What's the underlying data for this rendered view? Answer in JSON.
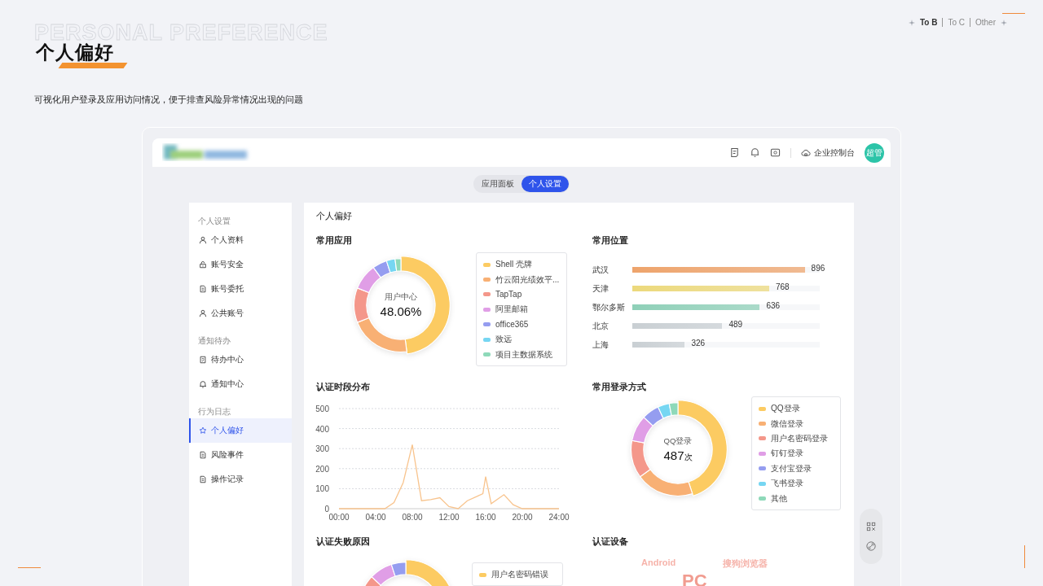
{
  "header": {
    "ghost_title": "PERSONAL PREFERENCE",
    "title": "个人偏好",
    "subtitle": "可视化用户登录及应用访问情况，便于排查风险异常情况出现的问题"
  },
  "audience_tabs": [
    {
      "label": "To B",
      "selected": true
    },
    {
      "label": "To C",
      "selected": false
    },
    {
      "label": "Other",
      "selected": false
    }
  ],
  "app": {
    "topbar": {
      "console_label": "企业控制台",
      "avatar": "超管"
    },
    "tabs": [
      {
        "label": "应用面板",
        "selected": false
      },
      {
        "label": "个人设置",
        "selected": true
      }
    ],
    "sidebar": [
      {
        "group": "个人设置",
        "items": [
          {
            "label": "个人资料",
            "selected": false
          },
          {
            "label": "账号安全",
            "selected": false
          },
          {
            "label": "账号委托",
            "selected": false
          },
          {
            "label": "公共账号",
            "selected": false
          }
        ]
      },
      {
        "group": "通知待办",
        "items": [
          {
            "label": "待办中心",
            "selected": false
          },
          {
            "label": "通知中心",
            "selected": false
          }
        ]
      },
      {
        "group": "行为日志",
        "items": [
          {
            "label": "个人偏好",
            "selected": true
          },
          {
            "label": "风险事件",
            "selected": false
          },
          {
            "label": "操作记录",
            "selected": false
          }
        ]
      }
    ],
    "panel": {
      "title": "个人偏好",
      "apps": {
        "title": "常用应用",
        "center_label": "用户中心",
        "center_value": "48.06%",
        "legend": [
          {
            "label": "Shell 壳牌",
            "color": "#fccb62"
          },
          {
            "label": "竹云阳光绩效平...",
            "color": "#f8b074"
          },
          {
            "label": "TapTap",
            "color": "#f4978a"
          },
          {
            "label": "阿里邮箱",
            "color": "#e09ee6"
          },
          {
            "label": "office365",
            "color": "#959df0"
          },
          {
            "label": "致远",
            "color": "#76d6f2"
          },
          {
            "label": "项目主数据系统",
            "color": "#8ed9b9"
          }
        ]
      },
      "locations": {
        "title": "常用位置",
        "rows": [
          {
            "city": "武汉",
            "value": "896",
            "level": 0.92,
            "color": "#eea46c"
          },
          {
            "city": "天津",
            "value": "768",
            "level": 0.73,
            "color": "#ecd97c"
          },
          {
            "city": "鄂尔多斯",
            "value": "636",
            "level": 0.68,
            "color": "#8fd0b8"
          },
          {
            "city": "北京",
            "value": "489",
            "level": 0.48,
            "color": "#c9cfd3"
          },
          {
            "city": "上海",
            "value": "326",
            "level": 0.28,
            "color": "#c9cfd3"
          }
        ]
      },
      "auth_time": {
        "title": "认证时段分布",
        "chart_data": {
          "type": "line",
          "grid": true,
          "x": [
            0,
            1,
            2,
            3,
            4,
            5,
            6,
            7,
            8,
            9,
            10,
            11,
            12,
            13,
            14,
            15,
            15.7,
            16,
            16.6,
            18,
            19,
            20,
            21,
            22,
            23,
            24
          ],
          "series": [
            {
              "color": "#f8c48e",
              "values": [
                0,
                0,
                0,
                0,
                0,
                0,
                30,
                130,
                320,
                40,
                45,
                55,
                10,
                0,
                40,
                60,
                75,
                160,
                25,
                70,
                20,
                0,
                0,
                0,
                0,
                0
              ]
            }
          ],
          "xlim": [
            0,
            24
          ],
          "ylim": [
            0,
            500
          ],
          "yticks": [
            0,
            100,
            200,
            300,
            400,
            500
          ],
          "xticks": [
            {
              "value": 0,
              "label": "00:00"
            },
            {
              "value": 4,
              "label": "04:00"
            },
            {
              "value": 8,
              "label": "08:00"
            },
            {
              "value": 12,
              "label": "12:00"
            },
            {
              "value": 16,
              "label": "16:00"
            },
            {
              "value": 20,
              "label": "20:00"
            },
            {
              "value": 24,
              "label": "24:00"
            }
          ]
        }
      },
      "login_methods": {
        "title": "常用登录方式",
        "center_label": "QQ登录",
        "center_value": "487",
        "center_unit": "次",
        "legend": [
          {
            "label": "QQ登录",
            "color": "#fccb62"
          },
          {
            "label": "微信登录",
            "color": "#f8b074"
          },
          {
            "label": "用户名密码登录",
            "color": "#f4978a"
          },
          {
            "label": "钉钉登录",
            "color": "#e09ee6"
          },
          {
            "label": "支付宝登录",
            "color": "#959df0"
          },
          {
            "label": "飞书登录",
            "color": "#76d6f2"
          },
          {
            "label": "其他",
            "color": "#8ed9b9"
          }
        ]
      },
      "failure_reasons": {
        "title": "认证失败原因",
        "legend": [
          {
            "label": "用户名密码错误",
            "color": "#fccb62"
          }
        ]
      },
      "devices": {
        "title": "认证设备",
        "words": [
          {
            "text": "Android",
            "kind": "small"
          },
          {
            "text": "搜狗浏览器",
            "kind": "small"
          },
          {
            "text": "PC",
            "kind": "large"
          }
        ]
      }
    }
  }
}
